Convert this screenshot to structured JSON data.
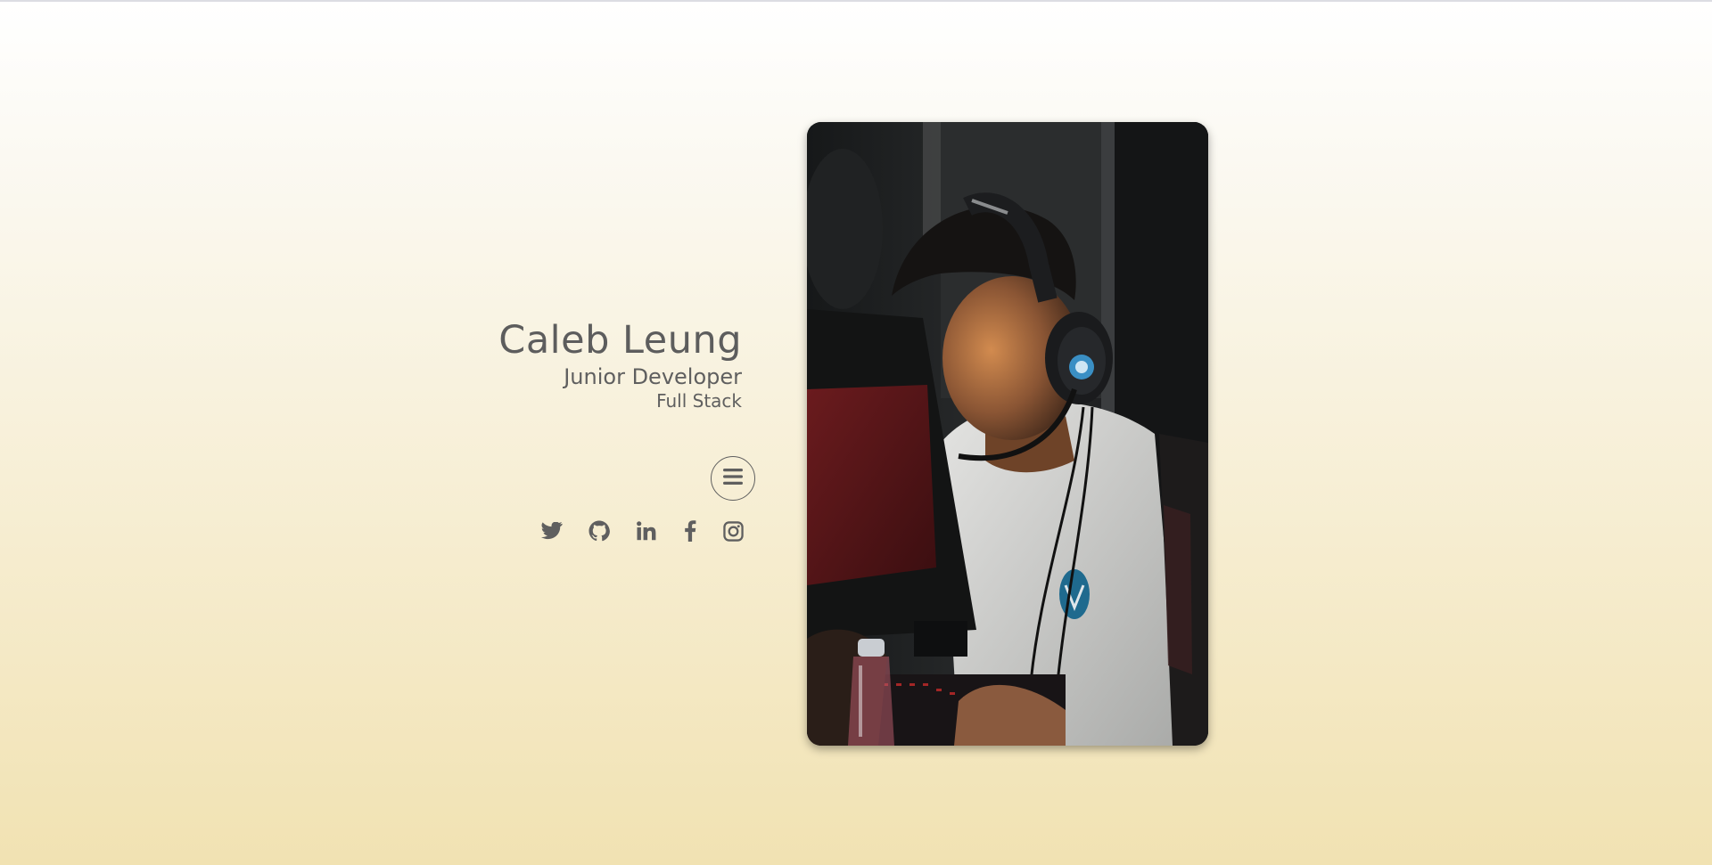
{
  "profile": {
    "name": "Caleb Leung",
    "role": "Junior Developer",
    "stack": "Full Stack"
  },
  "menu": {
    "icon": "hamburger-menu-icon"
  },
  "social_links": [
    {
      "name": "twitter",
      "icon": "twitter-icon"
    },
    {
      "name": "github",
      "icon": "github-icon"
    },
    {
      "name": "linkedin",
      "icon": "linkedin-icon"
    },
    {
      "name": "facebook",
      "icon": "facebook-icon"
    },
    {
      "name": "instagram",
      "icon": "instagram-icon"
    }
  ],
  "photo": {
    "subject": "person wearing headset at computer"
  },
  "colors": {
    "text": "#5f5f5f",
    "background_top": "#ffffff",
    "background_bottom": "#f1e2b2"
  }
}
